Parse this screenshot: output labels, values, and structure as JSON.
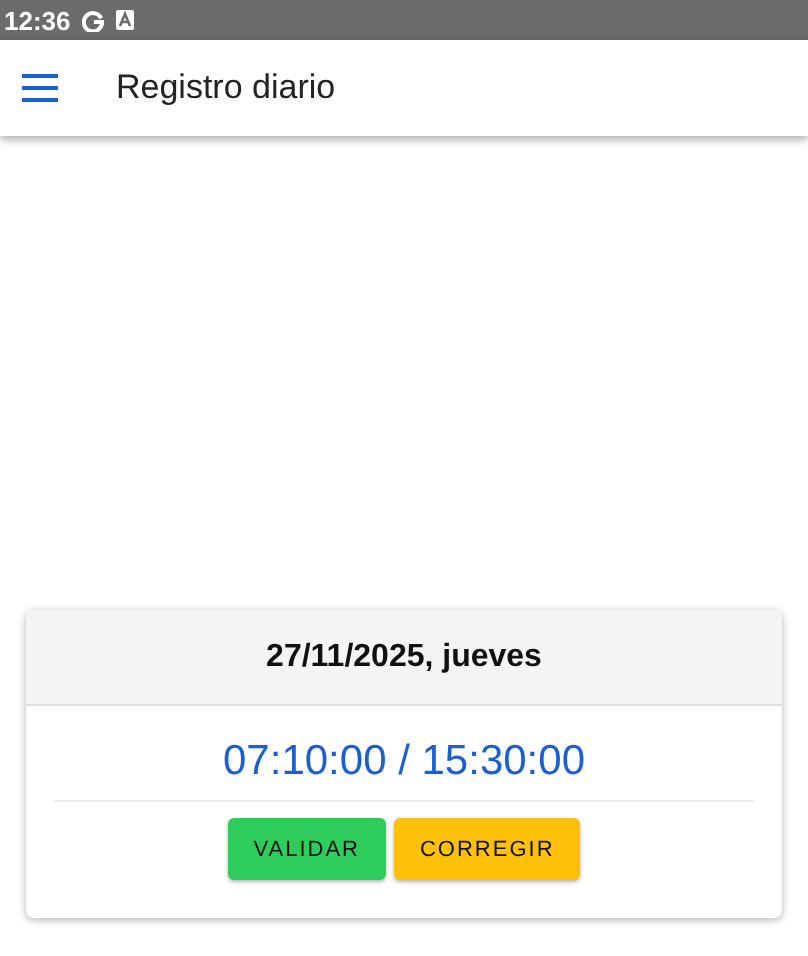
{
  "status_bar": {
    "time": "12:36"
  },
  "app_bar": {
    "title": "Registro diario"
  },
  "card": {
    "date": "27/11/2025, jueves",
    "hours": "07:10:00 / 15:30:00",
    "buttons": [
      {
        "label": "VALIDAR",
        "color": "#2ecc5a"
      },
      {
        "label": "CORREGIR",
        "color": "#ffc107"
      }
    ]
  }
}
